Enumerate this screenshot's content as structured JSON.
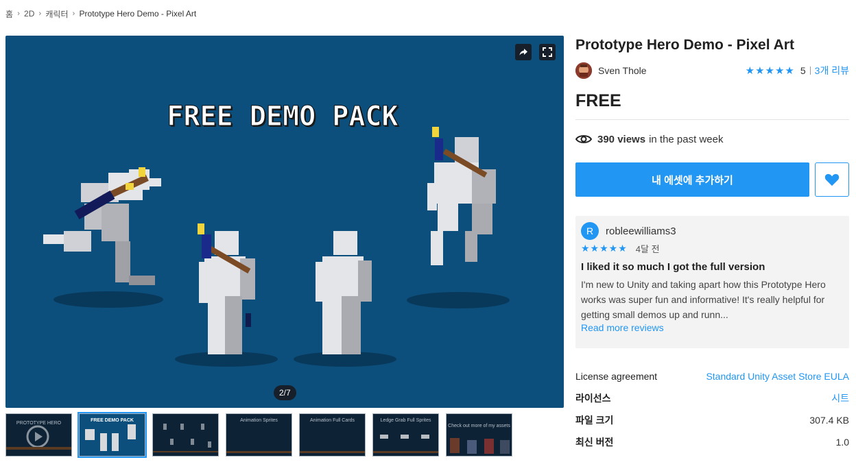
{
  "breadcrumb": [
    "홈",
    "2D",
    "캐릭터",
    "Prototype Hero Demo - Pixel Art"
  ],
  "hero": {
    "banner_text": "FREE DEMO PACK",
    "counter": "2/7"
  },
  "thumbnails": [
    {
      "label": "PROTOTYPE HERO"
    },
    {
      "label": "FREE DEMO PACK"
    },
    {
      "label": ""
    },
    {
      "label": "Animation Sprites"
    },
    {
      "label": "Animation Full Cards"
    },
    {
      "label": "Ledge Grab Full Sprites"
    },
    {
      "label": "Check out more of my assets"
    }
  ],
  "product": {
    "title": "Prototype Hero Demo - Pixel Art",
    "publisher": "Sven Thole",
    "rating_stars": "★★★★★",
    "rating": "5",
    "reviews_link": "3개 리뷰",
    "price": "FREE",
    "views_count": "390 views",
    "views_suffix": "in the past week",
    "add_button": "내 에셋에 추가하기"
  },
  "review": {
    "avatar_letter": "R",
    "user": "robleewilliams3",
    "stars": "★★★★★",
    "time": "4달 전",
    "title": "I liked it so much I got the full version",
    "body": "I'm new to Unity and taking apart how this Prototype Hero works was super fun and informative! It's really helpful for getting small demos up and runn...",
    "more": "Read more reviews"
  },
  "details": [
    {
      "label": "License agreement",
      "value": "Standard Unity Asset Store EULA",
      "link": true,
      "bold": false
    },
    {
      "label": "라이선스",
      "value": "시트",
      "link": true,
      "bold": true
    },
    {
      "label": "파일 크기",
      "value": "307.4 KB",
      "link": false,
      "bold": true
    },
    {
      "label": "최신 버전",
      "value": "1.0",
      "link": false,
      "bold": true
    }
  ],
  "colors": {
    "accent": "#2196f3",
    "hero_bg": "#0d4f7c"
  }
}
